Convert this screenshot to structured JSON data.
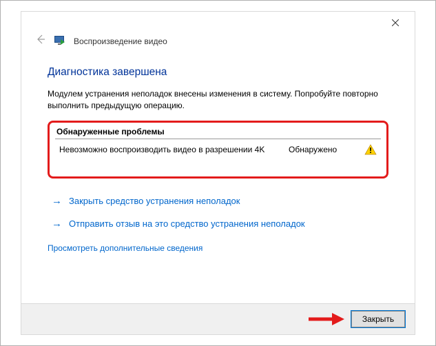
{
  "header": {
    "title": "Воспроизведение видео"
  },
  "main": {
    "diag_title": "Диагностика завершена",
    "diag_desc": "Модулем устранения неполадок внесены изменения в систему. Попробуйте повторно выполнить предыдущую операцию.",
    "problems_header": "Обнаруженные проблемы",
    "problems": [
      {
        "text": "Невозможно воспроизводить видео в разрешении 4K",
        "status": "Обнаружено"
      }
    ],
    "action_close_troubleshooter": "Закрыть средство устранения неполадок",
    "action_feedback": "Отправить отзыв на это средство устранения неполадок",
    "view_details": "Просмотреть дополнительные сведения"
  },
  "footer": {
    "close_label": "Закрыть"
  }
}
